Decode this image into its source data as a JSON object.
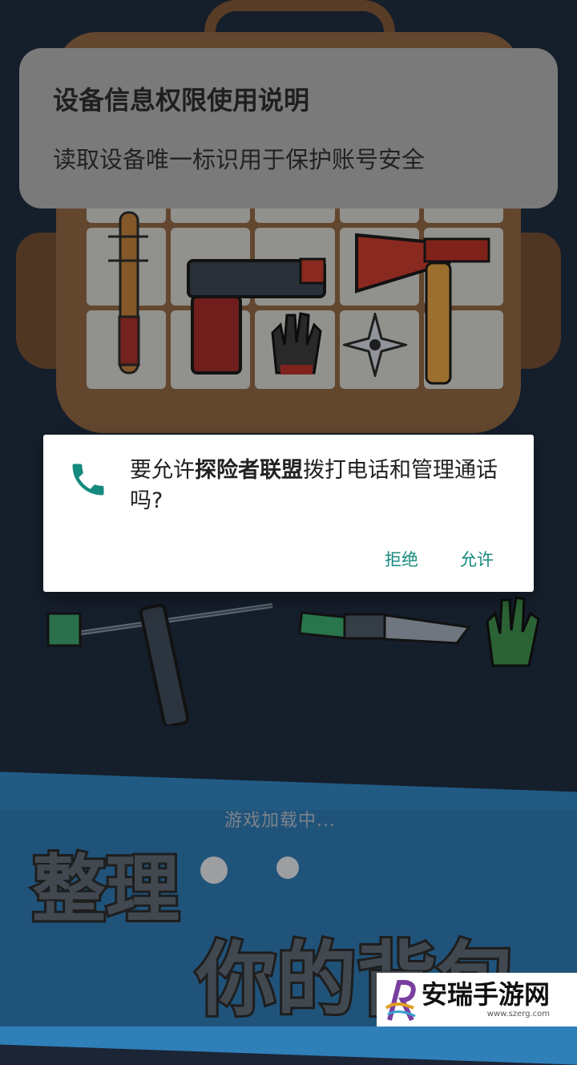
{
  "info_card": {
    "title": "设备信息权限使用说明",
    "body": "读取设备唯一标识用于保护账号安全"
  },
  "permission_dialog": {
    "prefix": "要允许",
    "app_name": "探险者联盟",
    "suffix": "拨打电话和管理通话吗?",
    "deny_label": "拒绝",
    "allow_label": "允许",
    "icon": "phone-icon",
    "accent_color": "#148a7e"
  },
  "game": {
    "loading_text": "游戏加载中...",
    "headline_line1": "整理",
    "headline_line2": "你的背包"
  },
  "watermark": {
    "name": "安瑞手游网",
    "url": "www.szerg.com"
  }
}
